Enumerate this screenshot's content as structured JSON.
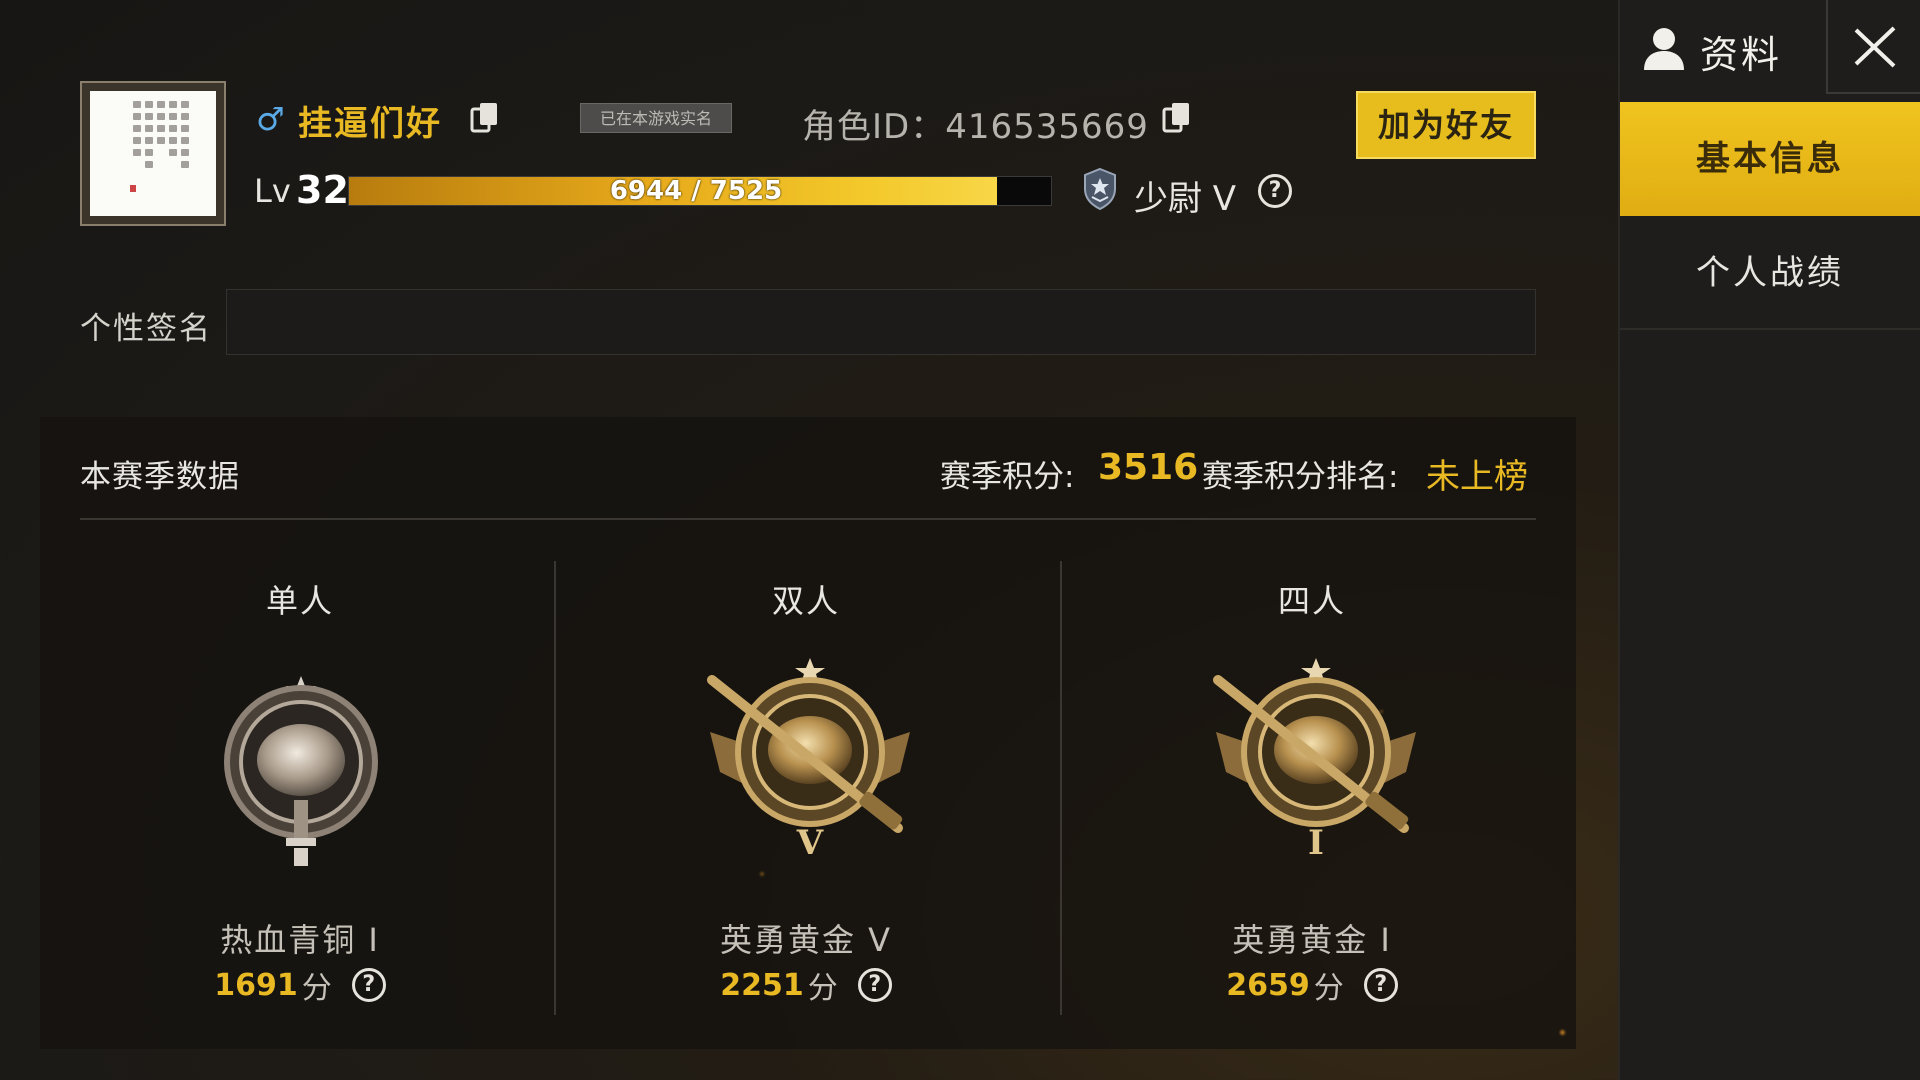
{
  "profile": {
    "gender_symbol": "♂",
    "nickname": "挂逼们好",
    "verified_badge": "已在本游戏实名",
    "role_id_label": "角色ID：416535669",
    "add_friend_label": "加为好友",
    "level_prefix": "Lv",
    "level": "32",
    "xp_text": "6944 / 7525",
    "xp_current": 6944,
    "xp_max": 7525,
    "rank_title": "少尉 V",
    "signature_label": "个性签名",
    "signature_value": ""
  },
  "season": {
    "title": "本赛季数据",
    "points_label": "赛季积分:",
    "points_value": "3516",
    "rank_label": "赛季积分排名:",
    "rank_value": "未上榜",
    "modes": [
      {
        "title": "单人",
        "tier": "热血青铜 I",
        "score": "1691",
        "unit": "分",
        "medal_icon": "bronze-pan-medal-icon"
      },
      {
        "title": "双人",
        "tier": "英勇黄金 V",
        "score": "2251",
        "unit": "分",
        "medal_icon": "gold-rifle-medal-icon"
      },
      {
        "title": "四人",
        "tier": "英勇黄金 I",
        "score": "2659",
        "unit": "分",
        "medal_icon": "gold-rifle-medal-icon"
      }
    ]
  },
  "sidebar": {
    "header_label": "资料",
    "tabs": [
      {
        "label": "基本信息",
        "active": true
      },
      {
        "label": "个人战绩",
        "active": false
      }
    ]
  },
  "colors": {
    "accent": "#e8b923",
    "active_tab": "#f0c41f",
    "gender": "#5aa9e6"
  }
}
